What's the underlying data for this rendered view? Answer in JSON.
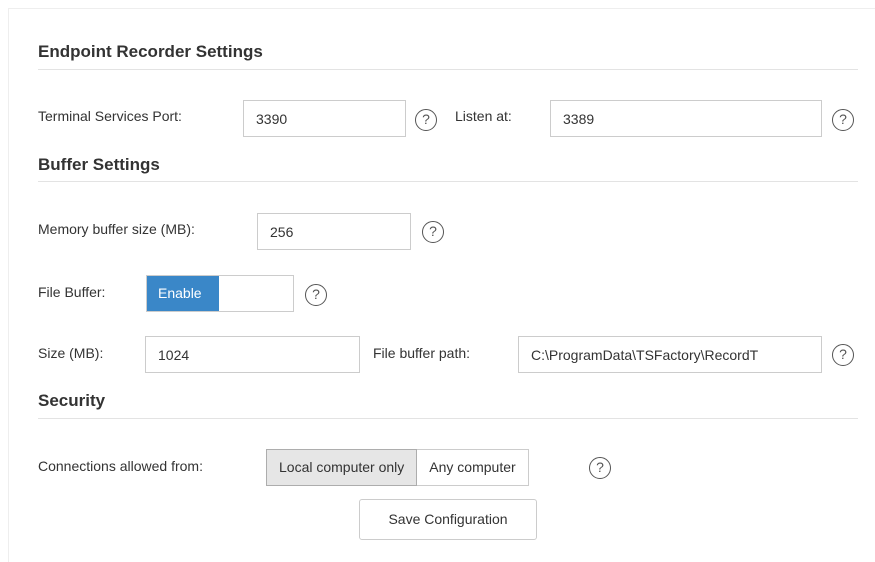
{
  "sections": {
    "endpoint": {
      "title": "Endpoint Recorder Settings",
      "ts_port_label": "Terminal Services Port:",
      "ts_port_value": "3390",
      "listen_label": "Listen at:",
      "listen_value": "3389"
    },
    "buffer": {
      "title": "Buffer Settings",
      "memory_label": "Memory buffer size (MB):",
      "memory_value": "256",
      "file_buffer_label": "File Buffer:",
      "file_buffer_toggle": "Enable",
      "size_label": "Size (MB):",
      "size_value": "1024",
      "path_label": "File buffer path:",
      "path_value": "C:\\ProgramData\\TSFactory\\RecordT"
    },
    "security": {
      "title": "Security",
      "connections_label": "Connections allowed from:",
      "options": [
        "Local computer only",
        "Any computer"
      ],
      "selected": "Local computer only"
    }
  },
  "help_glyph": "?",
  "save_label": "Save Configuration",
  "colors": {
    "accent": "#3a87c8",
    "selected_bg": "#e6e6e6"
  }
}
